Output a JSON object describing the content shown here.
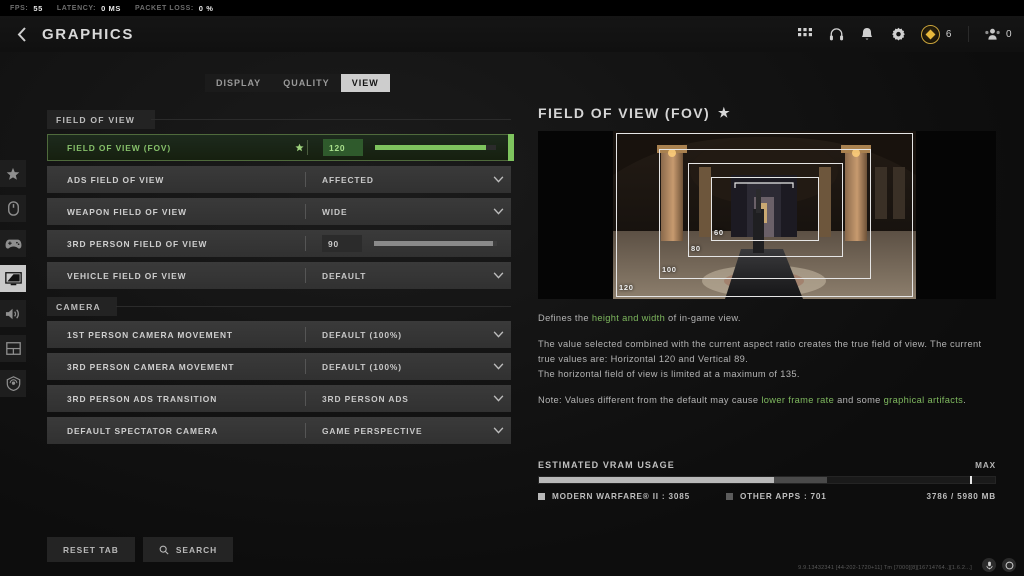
{
  "perf": {
    "items": [
      {
        "label": "FPS:",
        "value": "55"
      },
      {
        "label": "LATENCY:",
        "value": "0 MS"
      },
      {
        "label": "PACKET LOSS:",
        "value": "0 %"
      }
    ]
  },
  "header": {
    "back_icon": "chevron-left-icon",
    "title": "GRAPHICS",
    "icons": [
      "grid-icon",
      "headset-icon",
      "bell-icon",
      "gear-icon"
    ],
    "currency_count": "6",
    "party_count": "0"
  },
  "rail": {
    "items": [
      {
        "name": "star-icon",
        "active": false
      },
      {
        "name": "mouse-icon",
        "active": false
      },
      {
        "name": "controller-icon",
        "active": false
      },
      {
        "name": "monitor-icon",
        "active": true
      },
      {
        "name": "audio-icon",
        "active": false
      },
      {
        "name": "interface-icon",
        "active": false
      },
      {
        "name": "account-icon",
        "active": false
      }
    ]
  },
  "tabs": [
    {
      "label": "DISPLAY",
      "active": false
    },
    {
      "label": "QUALITY",
      "active": false
    },
    {
      "label": "VIEW",
      "active": true
    }
  ],
  "sections": [
    {
      "title": "FIELD OF VIEW",
      "rows": [
        {
          "name": "FIELD OF VIEW (FOV)",
          "value": "120",
          "type": "slider",
          "selected": true,
          "favorite": true,
          "fill_pct": 92
        },
        {
          "name": "ADS FIELD OF VIEW",
          "value": "AFFECTED",
          "type": "dropdown",
          "selected": false
        },
        {
          "name": "WEAPON FIELD OF VIEW",
          "value": "WIDE",
          "type": "dropdown",
          "selected": false
        },
        {
          "name": "3RD PERSON FIELD OF VIEW",
          "value": "90",
          "type": "slider",
          "selected": false,
          "fill_pct": 97
        },
        {
          "name": "VEHICLE FIELD OF VIEW",
          "value": "DEFAULT",
          "type": "dropdown",
          "selected": false
        }
      ]
    },
    {
      "title": "CAMERA",
      "rows": [
        {
          "name": "1ST PERSON CAMERA MOVEMENT",
          "value": "DEFAULT (100%)",
          "type": "dropdown",
          "selected": false
        },
        {
          "name": "3RD PERSON CAMERA MOVEMENT",
          "value": "DEFAULT (100%)",
          "type": "dropdown",
          "selected": false
        },
        {
          "name": "3RD PERSON ADS TRANSITION",
          "value": "3RD PERSON ADS",
          "type": "dropdown",
          "selected": false
        },
        {
          "name": "DEFAULT SPECTATOR CAMERA",
          "value": "GAME PERSPECTIVE",
          "type": "dropdown",
          "selected": false
        }
      ]
    }
  ],
  "detail": {
    "title": "FIELD OF VIEW (FOV)",
    "favorite_icon": "star-icon",
    "preview_labels": [
      "60",
      "80",
      "100",
      "120"
    ],
    "desc_line1_pre": "Defines the ",
    "desc_line1_hl": "height and width",
    "desc_line1_post": " of in-game view.",
    "desc_para2_a": "The value selected combined with the current aspect ratio creates the true field of view. The current true values are: Horizontal 120 and Vertical 89.",
    "desc_para2_b": "The horizontal field of view is limited at a maximum of 135.",
    "desc_note_pre": "Note: Values different from the default may cause ",
    "desc_note_hl1": "lower frame rate",
    "desc_note_mid": " and some ",
    "desc_note_hl2": "graphical artifacts",
    "desc_note_post": "."
  },
  "vram": {
    "title": "ESTIMATED VRAM USAGE",
    "max_label": "MAX",
    "game_legend": "MODERN WARFARE® II : 3085",
    "other_legend": "OTHER APPS : 701",
    "total": "3786 / 5980 MB",
    "game_pct": 51.5,
    "other_pct": 11.7,
    "max_pct": 94.5
  },
  "footer": {
    "reset_label": "RESET TAB",
    "search_label": "SEARCH",
    "search_icon": "search-icon",
    "build": "9.9.13432341 [44-202-1720+11] Tm [7000][8][16714764..][1.6.2...]"
  },
  "colors": {
    "accent_green": "#7ec45e",
    "selected_bg": "#1d2a1d",
    "row_bg": "#3a3a3a"
  }
}
